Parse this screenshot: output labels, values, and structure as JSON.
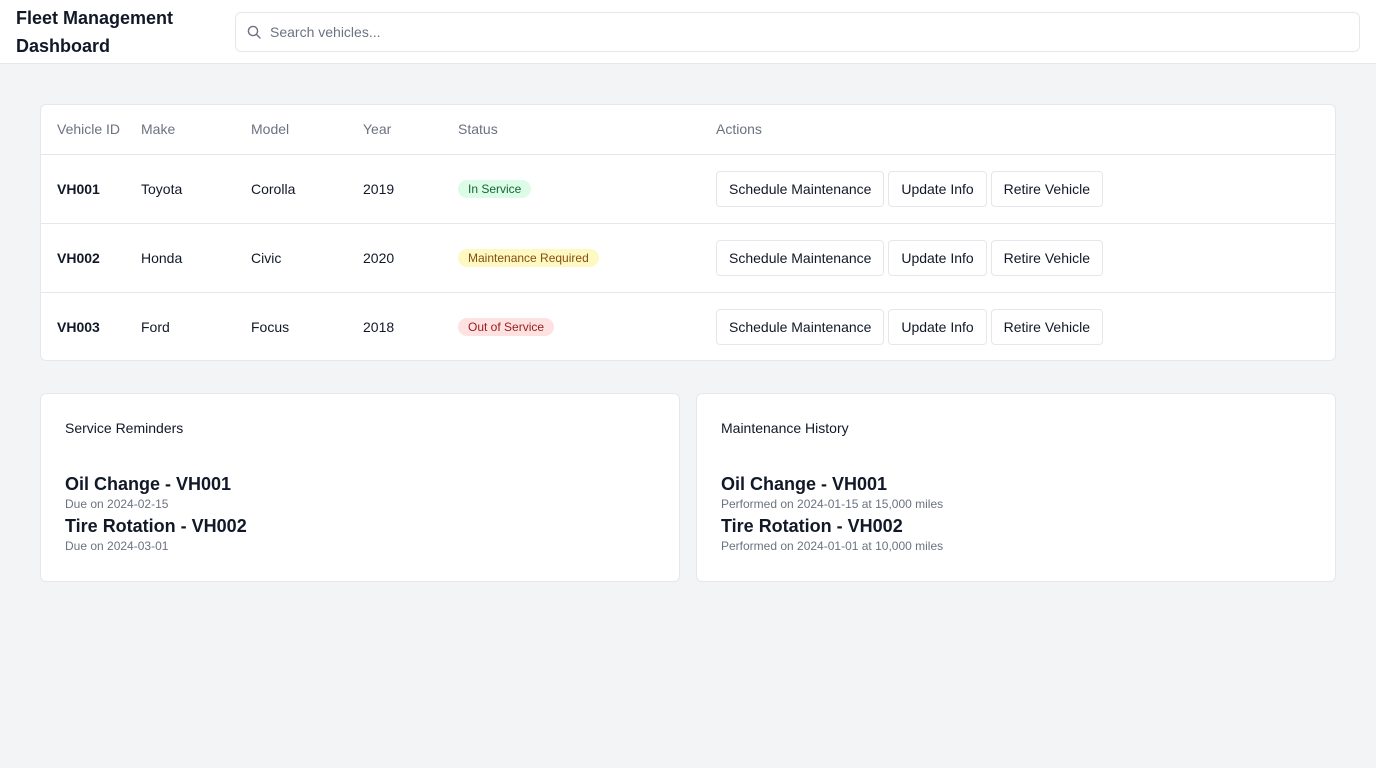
{
  "header": {
    "title": "Fleet Management Dashboard",
    "search_placeholder": "Search vehicles..."
  },
  "table": {
    "columns": [
      "Vehicle ID",
      "Make",
      "Model",
      "Year",
      "Status",
      "Actions"
    ],
    "rows": [
      {
        "id": "VH001",
        "make": "Toyota",
        "model": "Corolla",
        "year": "2019",
        "status": "In Service",
        "status_color": "#dcfce7"
      },
      {
        "id": "VH002",
        "make": "Honda",
        "model": "Civic",
        "year": "2020",
        "status": "Maintenance Required",
        "status_color": "#fef9c3"
      },
      {
        "id": "VH003",
        "make": "Ford",
        "model": "Focus",
        "year": "2018",
        "status": "Out of Service",
        "status_color": "#fee2e2"
      }
    ],
    "actions": {
      "schedule": "Schedule Maintenance",
      "update": "Update Info",
      "retire": "Retire Vehicle"
    }
  },
  "reminders": {
    "title": "Service Reminders",
    "items": [
      {
        "title": "Oil Change - VH001",
        "detail": "Due on 2024-02-15"
      },
      {
        "title": "Tire Rotation - VH002",
        "detail": "Due on 2024-03-01"
      }
    ]
  },
  "history": {
    "title": "Maintenance History",
    "items": [
      {
        "title": "Oil Change - VH001",
        "detail": "Performed on 2024-01-15 at 15,000 miles"
      },
      {
        "title": "Tire Rotation - VH002",
        "detail": "Performed on 2024-01-01 at 10,000 miles"
      }
    ]
  }
}
